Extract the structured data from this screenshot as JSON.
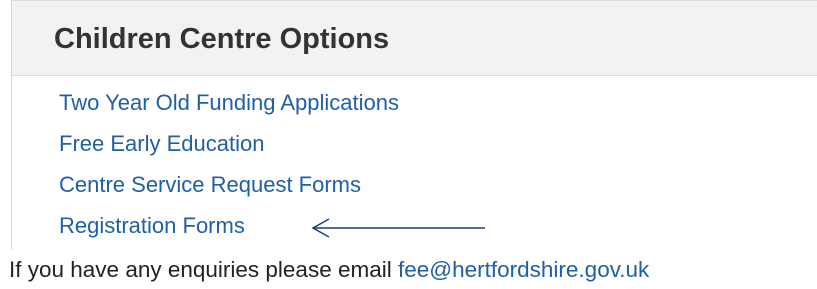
{
  "panel": {
    "title": "Children Centre Options",
    "links": [
      {
        "label": "Two Year Old Funding Applications"
      },
      {
        "label": "Free Early Education"
      },
      {
        "label": "Centre Service Request Forms"
      },
      {
        "label": "Registration Forms"
      }
    ]
  },
  "annotation": {
    "icon": "left-arrow-icon",
    "color": "#1f3f7a"
  },
  "footer": {
    "prefix": "If you have any enquiries please email",
    "email": "fee@hertfordshire.gov.uk"
  },
  "colors": {
    "link": "#1f5fa8",
    "header_bg": "#f2f2f2",
    "title": "#333333"
  }
}
